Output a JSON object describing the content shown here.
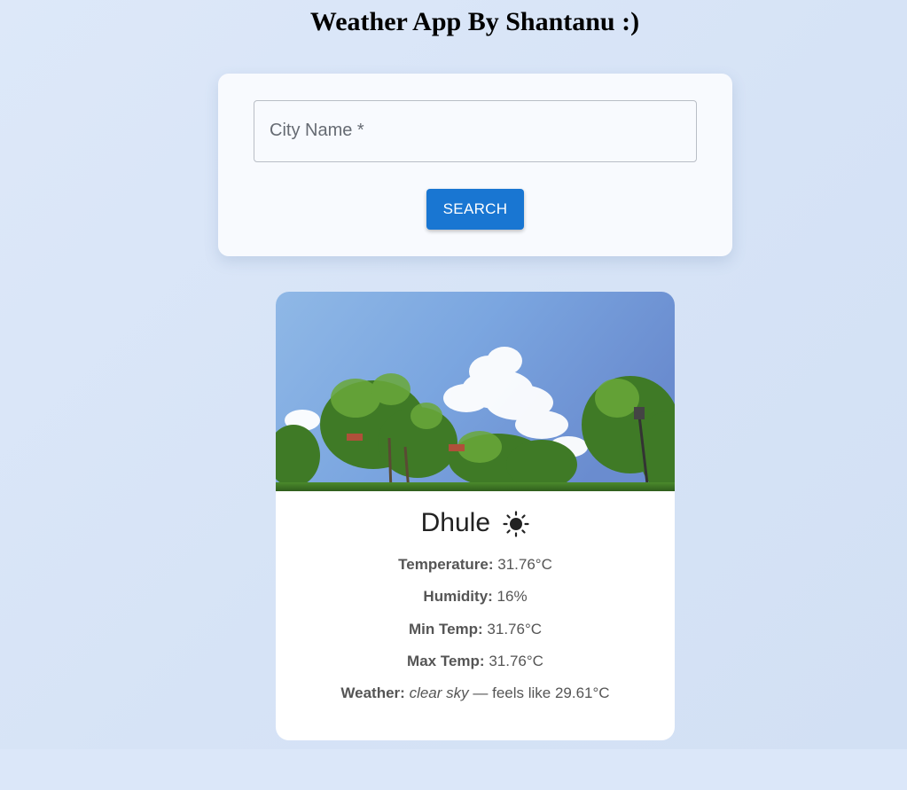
{
  "header": {
    "title": "Weather App By Shantanu :)"
  },
  "search": {
    "placeholder": "City Name *",
    "button_label": "SEARCH"
  },
  "weather": {
    "city": "Dhule",
    "icon": "sun-icon",
    "temperature_label": "Temperature:",
    "temperature_value": "31.76°C",
    "humidity_label": "Humidity:",
    "humidity_value": "16%",
    "min_temp_label": "Min Temp:",
    "min_temp_value": "31.76°C",
    "max_temp_label": "Max Temp:",
    "max_temp_value": "31.76°C",
    "weather_label": "Weather:",
    "description": "clear sky",
    "feels_like_text": "— feels like 29.61°C"
  },
  "colors": {
    "page_background": "#dbe7f9",
    "primary_button": "#1976d2",
    "card_background": "#ffffff"
  }
}
